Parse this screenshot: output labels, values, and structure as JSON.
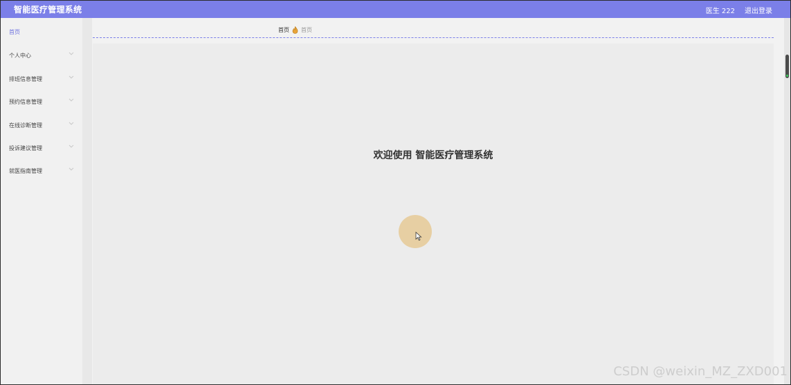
{
  "header": {
    "title": "智能医疗管理系统",
    "user": "医生 222",
    "logout": "退出登录",
    "bg_color": "#7b7fe8"
  },
  "sidebar": {
    "items": [
      {
        "label": "首页",
        "active": true,
        "has_chevron": false
      },
      {
        "label": "个人中心",
        "has_chevron": true
      },
      {
        "label": "排班信息管理",
        "has_chevron": true
      },
      {
        "label": "预约信息管理",
        "has_chevron": true
      },
      {
        "label": "在线诊断管理",
        "has_chevron": true
      },
      {
        "label": "投诉建议管理",
        "has_chevron": true
      },
      {
        "label": "就医指南管理",
        "has_chevron": true
      }
    ],
    "active_color": "#6f73df",
    "chevron_icon": "chevron-down-icon"
  },
  "breadcrumb": {
    "home": "首页",
    "icon": "fire-icon",
    "current": "首页"
  },
  "main": {
    "welcome": "欢迎使用 智能医疗管理系统"
  },
  "watermark": "CSDN @weixin_MZ_ZXD001"
}
